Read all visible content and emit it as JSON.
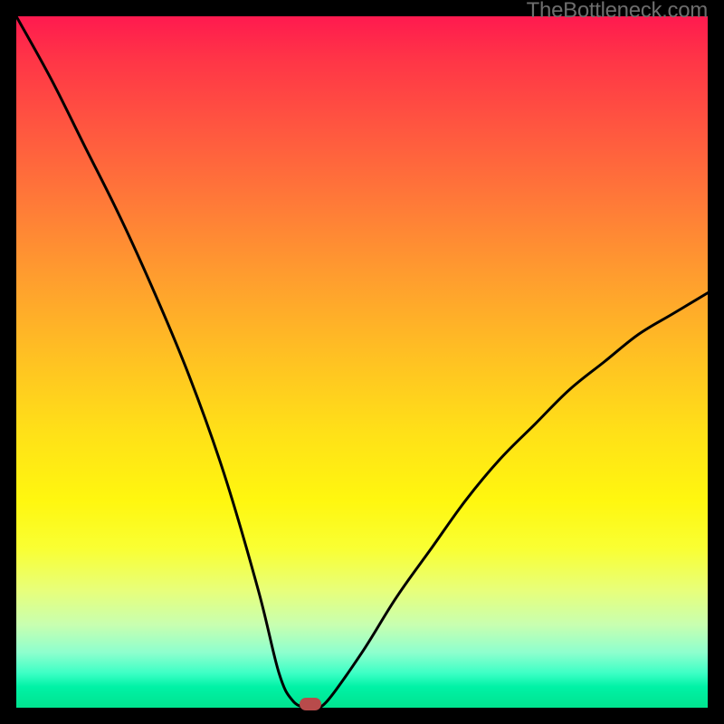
{
  "watermark": "TheBottleneck.com",
  "colors": {
    "frame": "#000000",
    "marker": "#b84b4b",
    "curve": "#000000"
  },
  "chart_data": {
    "type": "line",
    "title": "",
    "xlabel": "",
    "ylabel": "",
    "xlim": [
      0,
      100
    ],
    "ylim": [
      0,
      100
    ],
    "grid": false,
    "legend": false,
    "series": [
      {
        "name": "bottleneck-curve",
        "x": [
          0,
          5,
          10,
          15,
          20,
          25,
          30,
          35,
          38,
          40,
          42,
          43,
          45,
          50,
          55,
          60,
          65,
          70,
          75,
          80,
          85,
          90,
          95,
          100
        ],
        "y": [
          100,
          91,
          81,
          71,
          60,
          48,
          34,
          17,
          5,
          1,
          0,
          0,
          1,
          8,
          16,
          23,
          30,
          36,
          41,
          46,
          50,
          54,
          57,
          60
        ]
      }
    ],
    "optimal_point": {
      "x": 42.5,
      "y": 0
    },
    "background_gradient": {
      "type": "vertical",
      "stops": [
        {
          "pos": 0,
          "color": "#ff1a4f"
        },
        {
          "pos": 50,
          "color": "#ffc023"
        },
        {
          "pos": 75,
          "color": "#f9ff33"
        },
        {
          "pos": 100,
          "color": "#00e38e"
        }
      ]
    }
  }
}
